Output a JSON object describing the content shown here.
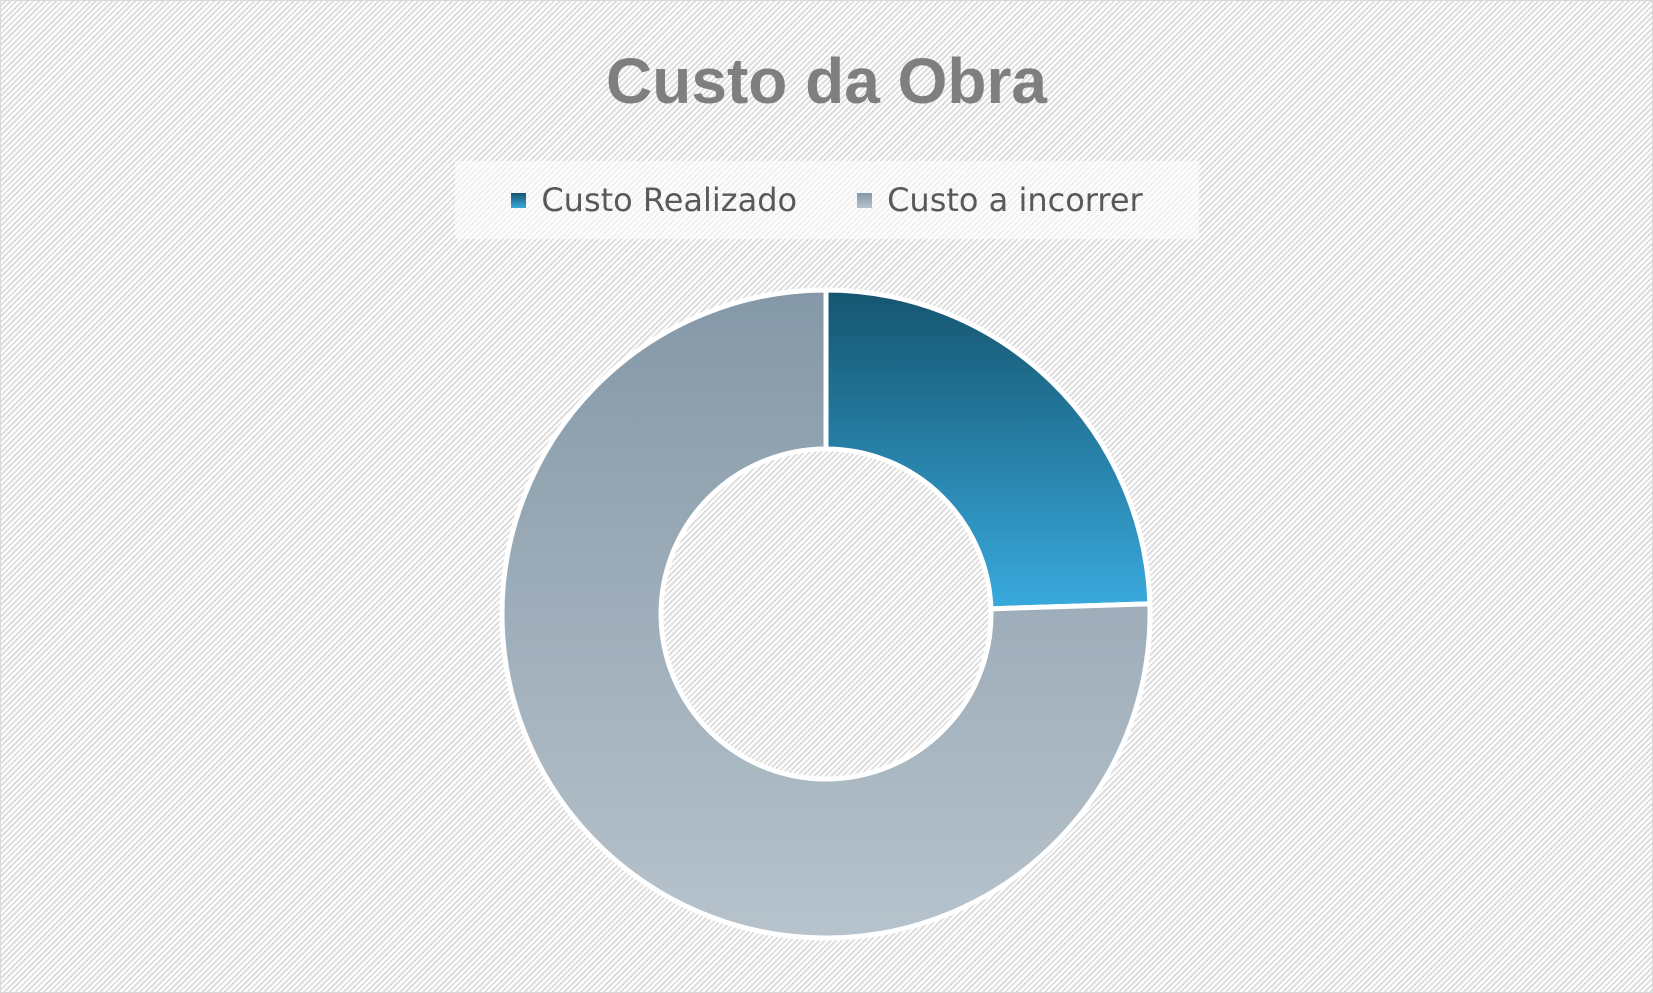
{
  "chart_data": {
    "type": "pie",
    "variant": "donut",
    "title": "Custo da Obra",
    "categories": [
      "Custo Realizado",
      "Custo a incorrer"
    ],
    "values": [
      24.5,
      75.5
    ],
    "value_unit": "percent (estimated)",
    "colors": [
      "#2b8cbf",
      "#9fafbb"
    ],
    "gradients": [
      [
        "#15556f",
        "#39a9dd"
      ],
      [
        "#8598a7",
        "#b7c3cc"
      ]
    ],
    "legend_position": "top",
    "data_labels": "none"
  },
  "background": {
    "fill": "#f2f2f2",
    "pattern": "diagonal-stripes",
    "border": "#d9d9d9"
  }
}
